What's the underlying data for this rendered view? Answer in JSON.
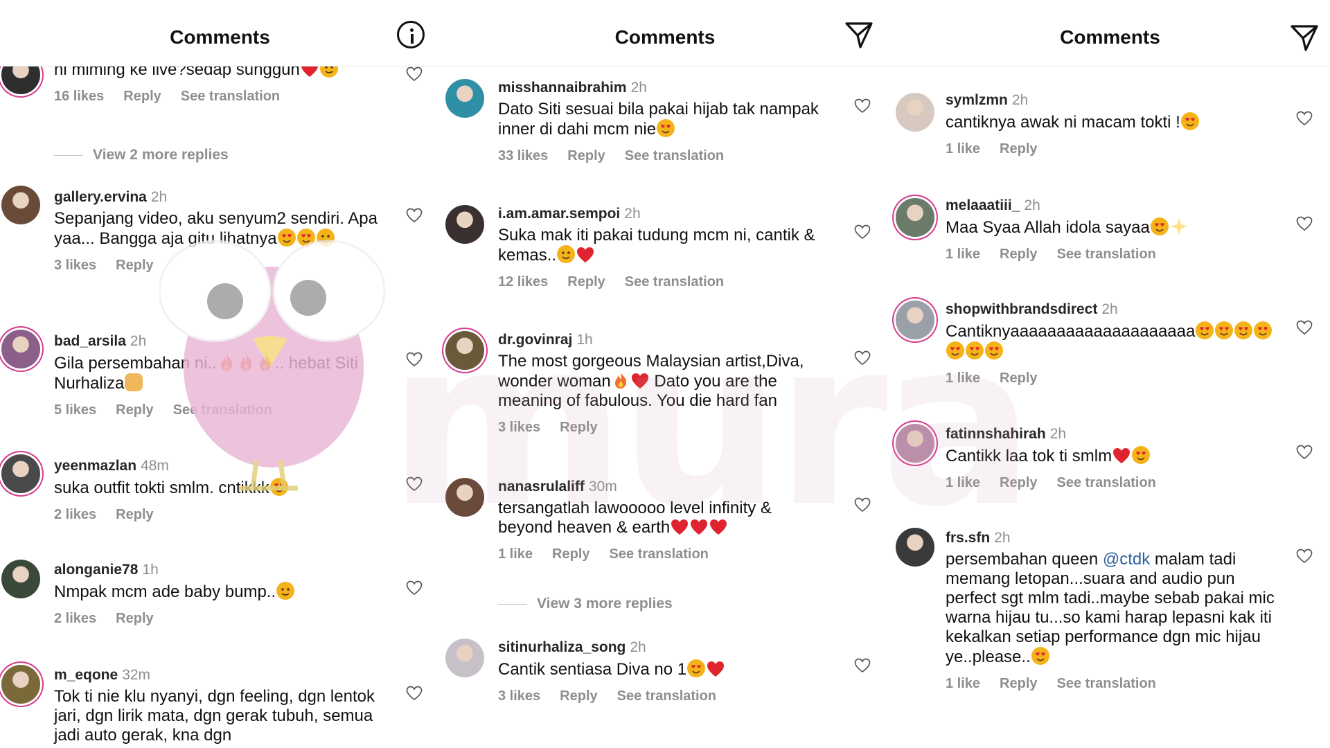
{
  "panels": [
    {
      "title": "Comments",
      "header_icon": "info-icon",
      "comments": [
        {
          "user": "",
          "time": "",
          "text": "ni miming ke live?sedap sungguh",
          "emojis": [
            "heart",
            "crying"
          ],
          "likes": "16 likes",
          "reply": "Reply",
          "translation": "See translation",
          "more_replies": "View 2 more replies"
        },
        {
          "user": "gallery.ervina",
          "time": "2h",
          "text": "Sepanjang video, aku senyum2 sendiri. Apa yaa... Bangga aja gitu lihatnya",
          "emojis": [
            "heart-eyes",
            "heart-eyes",
            "pleading"
          ],
          "likes": "3 likes",
          "reply": "Reply",
          "translation": ""
        },
        {
          "user": "bad_arsila",
          "time": "2h",
          "text": "Gila persembahan ni..",
          "text2": ".. hebat Siti Nurhaliza",
          "emojis": [
            "fire",
            "fire",
            "fire",
            "clap"
          ],
          "likes": "5 likes",
          "reply": "Reply",
          "translation": "See translation"
        },
        {
          "user": "yeenmazlan",
          "time": "48m",
          "text": "suka outfit tokti smlm. cntikkk",
          "emojis": [
            "heart-eyes"
          ],
          "likes": "2 likes",
          "reply": "Reply",
          "translation": ""
        },
        {
          "user": "alonganie78",
          "time": "1h",
          "text": "Nmpak mcm ade baby bump..",
          "emojis": [
            "sweat-smile"
          ],
          "likes": "2 likes",
          "reply": "Reply",
          "translation": ""
        },
        {
          "user": "m_eqone",
          "time": "32m",
          "text": "Tok ti nie klu nyanyi, dgn feeling, dgn lentok jari, dgn lirik mata, dgn gerak tubuh, semua jadi auto gerak, kna dgn",
          "emojis": [],
          "likes": "",
          "reply": "",
          "translation": ""
        }
      ]
    },
    {
      "title": "Comments",
      "header_icon": "send-icon",
      "comments": [
        {
          "user": "misshannaibrahim",
          "time": "2h",
          "text": "Dato Siti sesuai bila pakai hijab tak nampak inner di dahi mcm nie",
          "emojis": [
            "heart-eyes"
          ],
          "likes": "33 likes",
          "reply": "Reply",
          "translation": "See translation"
        },
        {
          "user": "i.am.amar.sempoi",
          "time": "2h",
          "text": "Suka mak iti pakai tudung mcm ni, cantik & kemas..",
          "emojis": [
            "smile",
            "heart"
          ],
          "likes": "12 likes",
          "reply": "Reply",
          "translation": "See translation"
        },
        {
          "user": "dr.govinraj",
          "time": "1h",
          "text": "The most gorgeous Malaysian artist,Diva, wonder woman",
          "text2": " Dato you are the meaning of fabulous.  You die hard fan",
          "emojis": [
            "fire",
            "heart"
          ],
          "likes": "3 likes",
          "reply": "Reply",
          "translation": ""
        },
        {
          "user": "nanasrulaliff",
          "time": "30m",
          "text": "tersangatlah lawooooo level infinity & beyond heaven & earth",
          "emojis": [
            "heart",
            "heart",
            "heart"
          ],
          "likes": "1 like",
          "reply": "Reply",
          "translation": "See translation",
          "more_replies": "View 3 more replies"
        },
        {
          "user": "sitinurhaliza_song",
          "time": "2h",
          "text": "Cantik sentiasa Diva no 1",
          "emojis": [
            "heart-eyes",
            "heart"
          ],
          "likes": "3 likes",
          "reply": "Reply",
          "translation": "See translation"
        }
      ]
    },
    {
      "title": "Comments",
      "header_icon": "send-icon",
      "comments": [
        {
          "user": "symlzmn",
          "time": "2h",
          "text": "cantiknya awak ni macam tokti !",
          "emojis": [
            "smiling-hearts"
          ],
          "likes": "1 like",
          "reply": "Reply",
          "translation": ""
        },
        {
          "user": "melaaatiii_",
          "time": "2h",
          "text": "Maa Syaa Allah idola sayaa",
          "emojis": [
            "heart-eyes",
            "sparkles"
          ],
          "likes": "1 like",
          "reply": "Reply",
          "translation": "See translation"
        },
        {
          "user": "shopwithbrandsdirect",
          "time": "2h",
          "text": "Cantiknyaaaaaaaaaaaaaaaaaaaa",
          "emojis": [
            "heart-eyes",
            "heart-eyes",
            "heart-eyes",
            "heart-eyes",
            "heart-eyes",
            "heart-eyes",
            "heart-eyes"
          ],
          "likes": "1 like",
          "reply": "Reply",
          "translation": ""
        },
        {
          "user": "fatinnshahirah",
          "time": "2h",
          "text": "Cantikk laa tok ti smlm",
          "emojis": [
            "heart",
            "heart-eyes"
          ],
          "likes": "1 like",
          "reply": "Reply",
          "translation": "See translation"
        },
        {
          "user": "frs.sfn",
          "time": "2h",
          "text_pre": "persembahan queen ",
          "mention": "@ctdk",
          "text": " malam tadi memang letopan...suara and audio pun perfect sgt mlm tadi..maybe sebab pakai mic warna hijau tu...so kami harap lepasni kak iti kekalkan setiap performance dgn mic hijau ye..please..",
          "emojis": [
            "smiling-hearts"
          ],
          "likes": "1 like",
          "reply": "Reply",
          "translation": "See translation"
        }
      ]
    }
  ],
  "watermark": "mura",
  "colors": {
    "ring": "#d63b8e",
    "meta": "#8e8e8e",
    "mention": "#2c5f9e",
    "heart_emoji": "#e0242f",
    "face_emoji": "#f5b31a"
  }
}
